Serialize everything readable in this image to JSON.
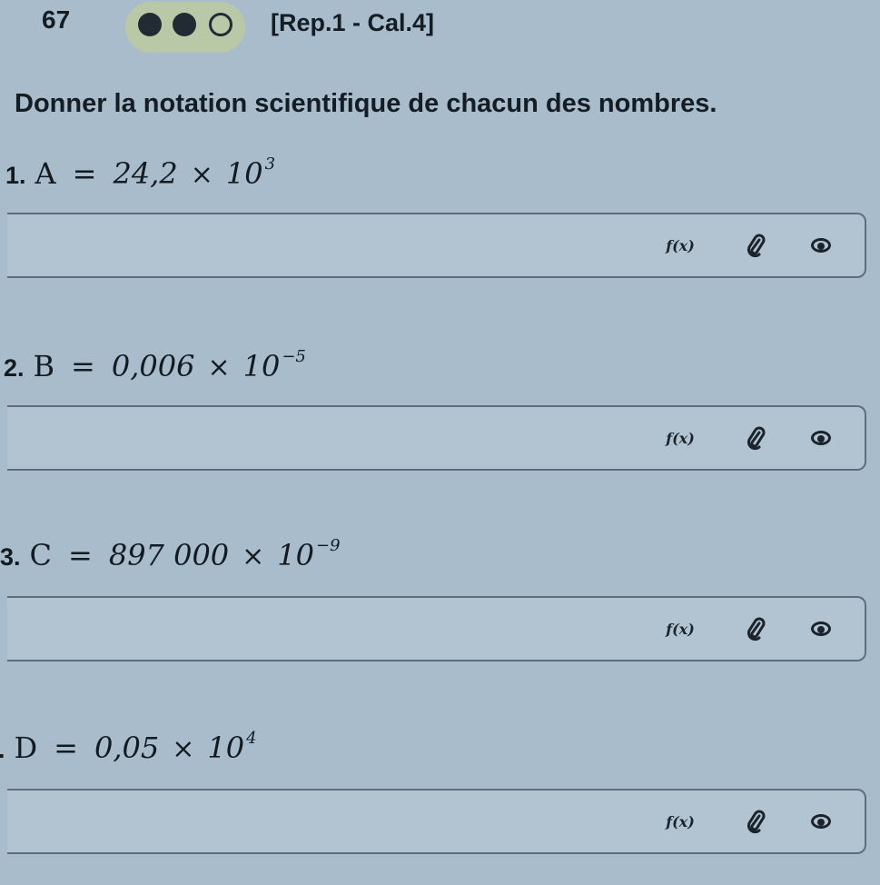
{
  "header": {
    "exercise_number": "67",
    "difficulty": {
      "filled": 2,
      "total": 3
    },
    "reference": "[Rep.1 - Cal.4]"
  },
  "instruction": "Donner la notation scientifique de chacun des nombres.",
  "questions": [
    {
      "number": "1.",
      "variable": "A",
      "equals": "=",
      "coefficient": "24,2",
      "times": "×",
      "base": "10",
      "exponent": "3",
      "tools": {
        "fx": "f(x)"
      }
    },
    {
      "number": "2.",
      "variable": "B",
      "equals": "=",
      "coefficient": "0,006",
      "times": "×",
      "base": "10",
      "exponent": "−5",
      "tools": {
        "fx": "f(x)"
      }
    },
    {
      "number": "3.",
      "variable": "C",
      "equals": "=",
      "coefficient": "897 000",
      "times": "×",
      "base": "10",
      "exponent": "−9",
      "tools": {
        "fx": "f(x)"
      }
    },
    {
      "number": ".",
      "variable": "D",
      "equals": "=",
      "coefficient": "0,05",
      "times": "×",
      "base": "10",
      "exponent": "4",
      "tools": {
        "fx": "f(x)"
      }
    }
  ],
  "icons": {
    "attachment": "paperclip-icon",
    "preview": "eye-icon"
  },
  "colors": {
    "background": "#a9bccb",
    "answer_box": "#b2c4d2",
    "difficulty_pill": "#b9c9a8",
    "text": "#141c24"
  }
}
